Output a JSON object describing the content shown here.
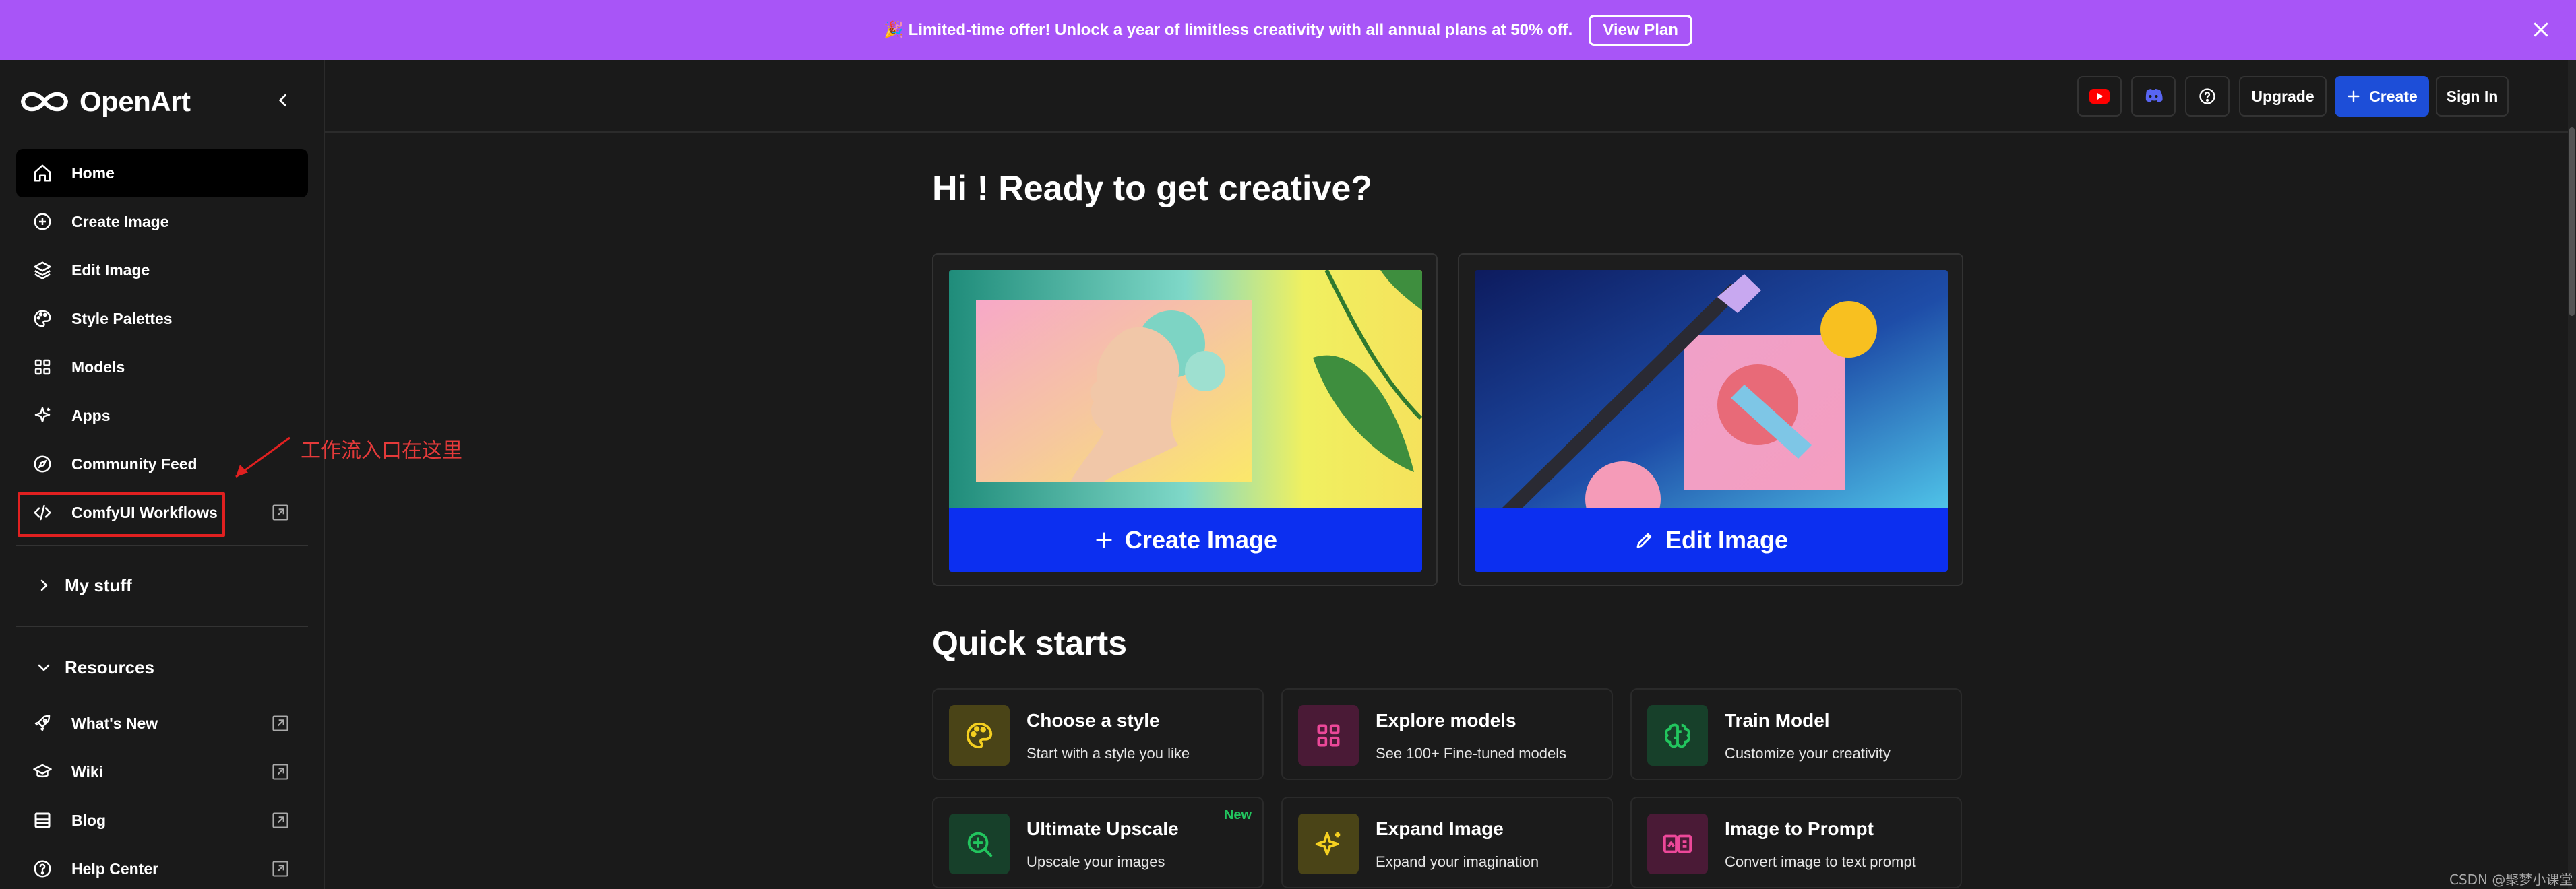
{
  "banner": {
    "text": "🎉 Limited-time offer! Unlock a year of limitless creativity with all annual plans at 50% off.",
    "button": "View Plan"
  },
  "sidebar": {
    "brand": "OpenArt",
    "items": [
      {
        "label": "Home",
        "icon": "home-icon"
      },
      {
        "label": "Create Image",
        "icon": "plus-circle-icon"
      },
      {
        "label": "Edit Image",
        "icon": "layers-icon"
      },
      {
        "label": "Style Palettes",
        "icon": "palette-icon"
      },
      {
        "label": "Models",
        "icon": "grid-icon"
      },
      {
        "label": "Apps",
        "icon": "sparkles-icon"
      },
      {
        "label": "Community Feed",
        "icon": "compass-icon"
      },
      {
        "label": "ComfyUI Workflows",
        "icon": "code-icon"
      }
    ],
    "my_stuff": "My stuff",
    "resources": "Resources",
    "resource_items": [
      {
        "label": "What's New",
        "icon": "rocket-icon"
      },
      {
        "label": "Wiki",
        "icon": "graduation-cap-icon"
      },
      {
        "label": "Blog",
        "icon": "blog-icon"
      },
      {
        "label": "Help Center",
        "icon": "help-circle-icon"
      }
    ]
  },
  "annotation": {
    "text": "工作流入口在这里",
    "color": "#e02020"
  },
  "topbar": {
    "upgrade": "Upgrade",
    "create": "Create",
    "sign_in": "Sign In"
  },
  "main": {
    "greeting": "Hi ! Ready to get creative?",
    "hero": [
      {
        "label": "Create Image",
        "icon": "plus-icon"
      },
      {
        "label": "Edit Image",
        "icon": "pencil-icon"
      }
    ],
    "quick_starts_title": "Quick starts",
    "quick_starts": [
      {
        "name": "Choose a style",
        "desc": "Start with a style you like",
        "icon": "palette-icon",
        "badge": ""
      },
      {
        "name": "Explore models",
        "desc": "See 100+ Fine-tuned models",
        "icon": "grid-icon",
        "badge": ""
      },
      {
        "name": "Train Model",
        "desc": "Customize your creativity",
        "icon": "brain-icon",
        "badge": ""
      },
      {
        "name": "Ultimate Upscale",
        "desc": "Upscale your images",
        "icon": "zoom-in-icon",
        "badge": "New"
      },
      {
        "name": "Expand Image",
        "desc": "Expand your imagination",
        "icon": "sparkles-icon",
        "badge": ""
      },
      {
        "name": "Image to Prompt",
        "desc": "Convert image to text prompt",
        "icon": "image-to-text-icon",
        "badge": ""
      }
    ]
  },
  "colors": {
    "banner": "#a855f7",
    "accent": "#0c2ff0",
    "youtube": "#ff0000",
    "discord": "#5865f2"
  },
  "watermark": "CSDN @聚梦小课堂"
}
